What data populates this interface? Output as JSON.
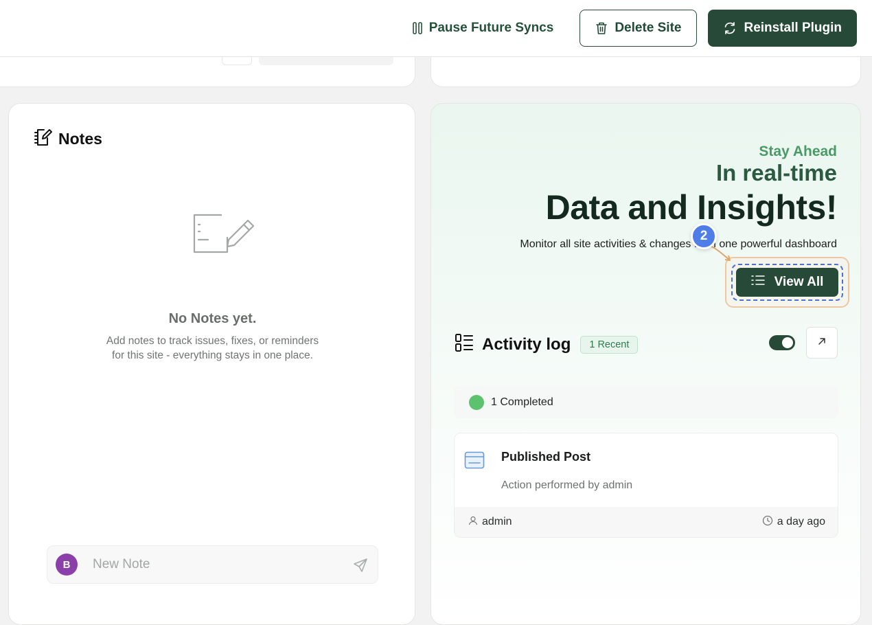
{
  "toolbar": {
    "pause_label": "Pause Future Syncs",
    "delete_label": "Delete Site",
    "reinstall_label": "Reinstall Plugin"
  },
  "notes": {
    "title": "Notes",
    "empty_title": "No Notes yet.",
    "empty_desc_line1": "Add notes to track issues, fixes, or reminders",
    "empty_desc_line2": "for this site - everything stays in one place.",
    "avatar_initial": "B",
    "input_placeholder": "New Note"
  },
  "insights": {
    "kicker": "Stay Ahead",
    "headline_small": "In real-time",
    "headline_big": "Data and Insights!",
    "subtitle": "Monitor all site activities & changes from one powerful dashboard",
    "view_all_label": "View All",
    "step_number": "2"
  },
  "activity": {
    "title": "Activity log",
    "badge": "1 Recent",
    "toggle_on": true,
    "completed_label": "1 Completed",
    "items": [
      {
        "title": "Published Post",
        "subtitle": "Action performed by admin",
        "user": "admin",
        "time": "a day ago"
      }
    ]
  },
  "colors": {
    "brand_dark": "#264a37",
    "accent_green": "#4a9a68",
    "step_badge": "#4f7ee8",
    "status_dot": "#5cc26e",
    "avatar": "#8b3fa8"
  },
  "icons": [
    "pause-icon",
    "trash-icon",
    "refresh-icon",
    "notes-icon",
    "empty-notes-illustration",
    "send-icon",
    "list-icon",
    "activity-list-icon",
    "external-link-icon",
    "card-icon",
    "user-icon",
    "clock-icon"
  ]
}
